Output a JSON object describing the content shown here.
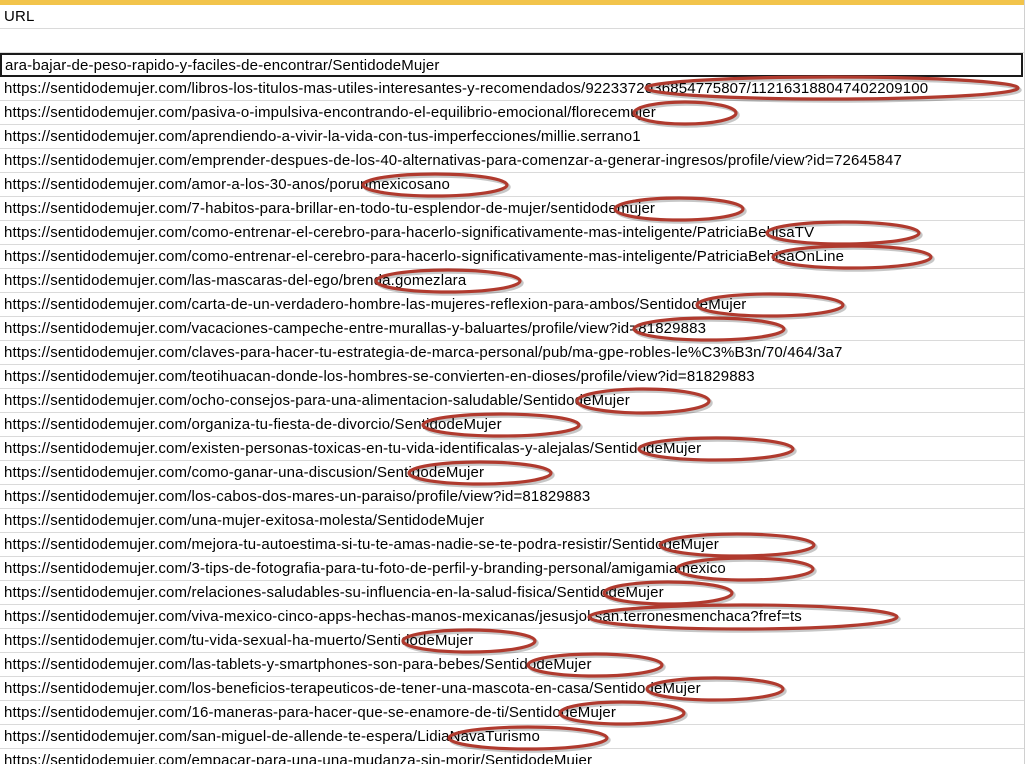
{
  "sheet": {
    "header": "URL",
    "active_cell": "ara-bajar-de-peso-rapido-y-faciles-de-encontrar/SentidodeMujer",
    "rows": [
      "https://sentidodemujer.com/libros-los-titulos-mas-utiles-interesantes-y-recomendados/9223372036854775807/112163188047402209100",
      "https://sentidodemujer.com/pasiva-o-impulsiva-encontrando-el-equilibrio-emocional/florecemujer",
      "https://sentidodemujer.com/aprendiendo-a-vivir-la-vida-con-tus-imperfecciones/millie.serrano1",
      "https://sentidodemujer.com/emprender-despues-de-los-40-alternativas-para-comenzar-a-generar-ingresos/profile/view?id=72645847",
      "https://sentidodemujer.com/amor-a-los-30-anos/porunmexicosano",
      "https://sentidodemujer.com/7-habitos-para-brillar-en-todo-tu-esplendor-de-mujer/sentidodemujer",
      "https://sentidodemujer.com/como-entrenar-el-cerebro-para-hacerlo-significativamente-mas-inteligente/PatriciaBehisaTV",
      "https://sentidodemujer.com/como-entrenar-el-cerebro-para-hacerlo-significativamente-mas-inteligente/PatriciaBehisaOnLine",
      "https://sentidodemujer.com/las-mascaras-del-ego/brenda.gomezlara",
      "https://sentidodemujer.com/carta-de-un-verdadero-hombre-las-mujeres-reflexion-para-ambos/SentidodeMujer",
      "https://sentidodemujer.com/vacaciones-campeche-entre-murallas-y-baluartes/profile/view?id=81829883",
      "https://sentidodemujer.com/claves-para-hacer-tu-estrategia-de-marca-personal/pub/ma-gpe-robles-le%C3%B3n/70/464/3a7",
      "https://sentidodemujer.com/teotihuacan-donde-los-hombres-se-convierten-en-dioses/profile/view?id=81829883",
      "https://sentidodemujer.com/ocho-consejos-para-una-alimentacion-saludable/SentidodeMujer",
      "https://sentidodemujer.com/organiza-tu-fiesta-de-divorcio/SentidodeMujer",
      "https://sentidodemujer.com/existen-personas-toxicas-en-tu-vida-identificalas-y-alejalas/SentidodeMujer",
      "https://sentidodemujer.com/como-ganar-una-discusion/SentidodeMujer",
      "https://sentidodemujer.com/los-cabos-dos-mares-un-paraiso/profile/view?id=81829883",
      "https://sentidodemujer.com/una-mujer-exitosa-molesta/SentidodeMujer",
      "https://sentidodemujer.com/mejora-tu-autoestima-si-tu-te-amas-nadie-se-te-podra-resistir/SentidodeMujer",
      "https://sentidodemujer.com/3-tips-de-fotografia-para-tu-foto-de-perfil-y-branding-personal/amigamiamexico",
      "https://sentidodemujer.com/relaciones-saludables-su-influencia-en-la-salud-fisica/SentidodeMujer",
      "https://sentidodemujer.com/viva-mexico-cinco-apps-hechas-manos-mexicanas/jesusjoksan.terronesmenchaca?fref=ts",
      "https://sentidodemujer.com/tu-vida-sexual-ha-muerto/SentidodeMujer",
      "https://sentidodemujer.com/las-tablets-y-smartphones-son-para-bebes/SentidodeMujer",
      "https://sentidodemujer.com/los-beneficios-terapeuticos-de-tener-una-mascota-en-casa/SentidodeMujer",
      "https://sentidodemujer.com/16-maneras-para-hacer-que-se-enamore-de-ti/SentidodeMujer",
      "https://sentidodemujer.com/san-miguel-de-allende-te-espera/LidiaNavaTurismo",
      "https://sentidodemujer.com/empacar-para-una-una-mudanza-sin-morir/SentidodeMujer"
    ]
  },
  "colors": {
    "header_bar": "#f2c44b",
    "annotation_oval": "#b03a2e",
    "grid_line": "#dadada"
  }
}
